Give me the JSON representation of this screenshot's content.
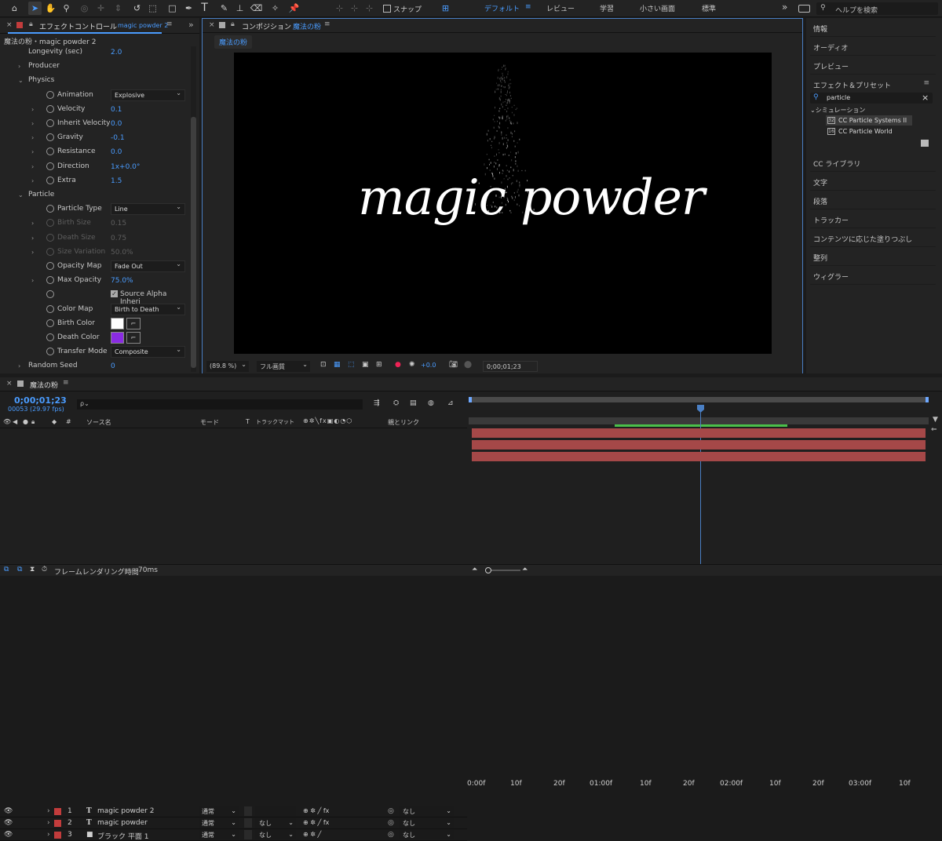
{
  "toolbar": {
    "snap_label": "スナップ",
    "workspaces": [
      "デフォルト",
      "レビュー",
      "学習",
      "小さい画面",
      "標準"
    ],
    "active_workspace": "デフォルト",
    "search_placeholder": "ヘルプを検索",
    "more": "»"
  },
  "effect_panel": {
    "tab_title": "エフェクトコントロール",
    "tab_layer": "magic powder 2",
    "breadcrumb": "魔法の粉・magic powder 2",
    "rows": [
      {
        "indent": 1,
        "label": "Longevity (sec)",
        "value": "2.0"
      },
      {
        "indent": 1,
        "twirl": "›",
        "label": "Producer"
      },
      {
        "indent": 1,
        "twirl": "⌄",
        "label": "Physics"
      },
      {
        "indent": 2,
        "sw": true,
        "label": "Animation",
        "dropdown": "Explosive"
      },
      {
        "indent": 2,
        "twirl": "›",
        "sw": true,
        "label": "Velocity",
        "value": "0.1"
      },
      {
        "indent": 2,
        "twirl": "›",
        "sw": true,
        "label": "Inherit Velocity",
        "value": "0.0"
      },
      {
        "indent": 2,
        "twirl": "›",
        "sw": true,
        "label": "Gravity",
        "value": "-0.1"
      },
      {
        "indent": 2,
        "twirl": "›",
        "sw": true,
        "label": "Resistance",
        "value": "0.0"
      },
      {
        "indent": 2,
        "twirl": "›",
        "sw": true,
        "label": "Direction",
        "value": "1x+0.0°"
      },
      {
        "indent": 2,
        "twirl": "›",
        "sw": true,
        "label": "Extra",
        "value": "1.5"
      },
      {
        "indent": 1,
        "twirl": "⌄",
        "label": "Particle"
      },
      {
        "indent": 2,
        "sw": true,
        "label": "Particle Type",
        "dropdown": "Line"
      },
      {
        "indent": 2,
        "twirl": "›",
        "sw": true,
        "label": "Birth Size",
        "value": "0.15",
        "disabled": true
      },
      {
        "indent": 2,
        "twirl": "›",
        "sw": true,
        "label": "Death Size",
        "value": "0.75",
        "disabled": true
      },
      {
        "indent": 2,
        "twirl": "›",
        "sw": true,
        "label": "Size Variation",
        "value": "50.0%",
        "disabled": true
      },
      {
        "indent": 2,
        "sw": true,
        "label": "Opacity Map",
        "dropdown": "Fade Out"
      },
      {
        "indent": 2,
        "twirl": "›",
        "sw": true,
        "label": "Max Opacity",
        "value": "75.0%"
      },
      {
        "indent": 2,
        "sw": true,
        "checkbox": "Source Alpha Inheri"
      },
      {
        "indent": 2,
        "sw": true,
        "label": "Color Map",
        "dropdown": "Birth to Death"
      },
      {
        "indent": 2,
        "sw": true,
        "label": "Birth Color",
        "color": "#ffffff"
      },
      {
        "indent": 2,
        "sw": true,
        "label": "Death Color",
        "color": "#8a2be2"
      },
      {
        "indent": 2,
        "sw": true,
        "label": "Transfer Mode",
        "dropdown": "Composite"
      },
      {
        "indent": 1,
        "twirl": "›",
        "label": "Random Seed",
        "value": "0"
      }
    ]
  },
  "composition": {
    "tab_title": "コンポジション",
    "tab_name": "魔法の粉",
    "flow_tab": "魔法の粉",
    "canvas_text": "magic powder",
    "zoom": "(89.8 %)",
    "quality": "フル画質",
    "exposure": "+0.0",
    "timecode": "0;00;01;23"
  },
  "right_panel": {
    "items_top": [
      "情報",
      "オーディオ",
      "プレビュー"
    ],
    "effects_title": "エフェクト＆プリセット",
    "search_value": "particle",
    "folder": "シミュレーション",
    "effects": [
      "CC Particle Systems II",
      "CC Particle World"
    ],
    "items_bottom": [
      "CC ライブラリ",
      "文字",
      "段落",
      "トラッカー",
      "コンテンツに応じた塗りつぶし",
      "整列",
      "ウィグラー"
    ]
  },
  "timeline": {
    "tab_title": "魔法の粉",
    "timecode": "0;00;01;23",
    "frames": "00053 (29.97 fps)",
    "search_placeholder": "ρ⌄",
    "headers": {
      "num": "#",
      "source": "ソース名",
      "mode": "モード",
      "t": "T",
      "trackmatte": "トラックマット",
      "parent": "親とリンク"
    },
    "layers": [
      {
        "num": "1",
        "type": "T",
        "name": "magic powder 2",
        "mode": "通常",
        "track": "",
        "parent": "なし",
        "fx": true
      },
      {
        "num": "2",
        "type": "T",
        "name": "magic powder",
        "mode": "通常",
        "track": "なし",
        "parent": "なし",
        "fx": true
      },
      {
        "num": "3",
        "type": "■",
        "name": "ブラック 平面 1",
        "mode": "通常",
        "track": "なし",
        "parent": "なし",
        "fx": false
      }
    ],
    "ruler": [
      "0:00f",
      "10f",
      "20f",
      "01:00f",
      "10f",
      "20f",
      "02:00f",
      "10f",
      "20f",
      "03:00f",
      "10f"
    ],
    "status": "フレームレンダリング時間",
    "render_time": "70ms"
  }
}
